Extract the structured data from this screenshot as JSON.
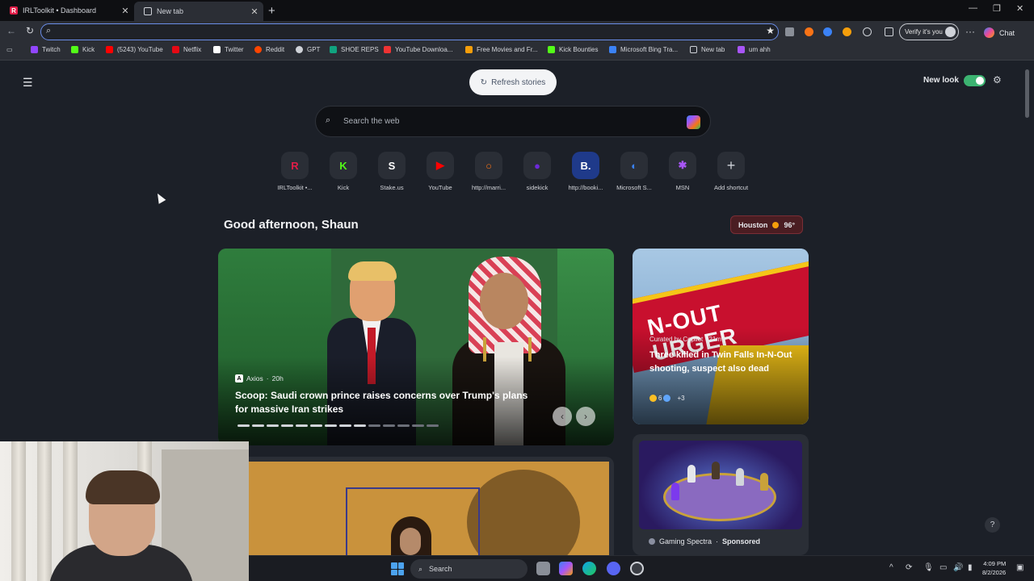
{
  "browser": {
    "tabs": [
      {
        "title": "IRLToolkit • Dashboard"
      },
      {
        "title": "New tab"
      }
    ],
    "new_tab_symbol": "+",
    "address": {
      "value": "",
      "placeholder": ""
    },
    "verify_label": "Verify it's you",
    "chat_label": "Chat",
    "more_symbol": "···"
  },
  "bookmarks": [
    {
      "label": "Twitch",
      "color": "#9146ff"
    },
    {
      "label": "Kick",
      "color": "#53fc18"
    },
    {
      "label": "(5243) YouTube",
      "color": "#ff0000"
    },
    {
      "label": "Netflix",
      "color": "#e50914"
    },
    {
      "label": "Twitter",
      "color": "#ffffff"
    },
    {
      "label": "Reddit",
      "color": "#ff4500"
    },
    {
      "label": "GPT",
      "color": "#cfd2d8"
    },
    {
      "label": "SHOE REPS",
      "color": "#10a37f"
    },
    {
      "label": "YouTube Downloa...",
      "color": "#e33"
    },
    {
      "label": "Free Movies and Fr...",
      "color": "#f59e0b"
    },
    {
      "label": "Kick Bounties",
      "color": "#53fc18"
    },
    {
      "label": "Microsoft Bing Tra...",
      "color": "#3b82f6"
    },
    {
      "label": "New tab",
      "color": "#cfd2d8"
    },
    {
      "label": "um ahh",
      "color": "#a855f7"
    }
  ],
  "newtab": {
    "refresh_label": "Refresh stories",
    "new_look_label": "New look",
    "new_look_on": true,
    "search_placeholder": "Search the web",
    "greeting": "Good afternoon, Shaun",
    "weather": {
      "city": "Houston",
      "temp": "96°"
    },
    "help_symbol": "?"
  },
  "shortcuts": [
    {
      "label": "IRLToolkit •...",
      "glyph": "R",
      "color": "#e11d48"
    },
    {
      "label": "Kick",
      "glyph": "K",
      "color": "#53fc18"
    },
    {
      "label": "Stake.us",
      "glyph": "S",
      "color": "#ffffff"
    },
    {
      "label": "YouTube",
      "glyph": "▶",
      "color": "#ff0000"
    },
    {
      "label": "http://marri...",
      "glyph": "○",
      "color": "#f97316"
    },
    {
      "label": "sidekick",
      "glyph": "●",
      "color": "#6d28d9"
    },
    {
      "label": "http://booki...",
      "glyph": "B.",
      "color": "#ffffff"
    },
    {
      "label": "Microsoft S...",
      "glyph": "◐",
      "color": "#3b82f6"
    },
    {
      "label": "MSN",
      "glyph": "✱",
      "color": "#a855f7"
    },
    {
      "label": "Add shortcut",
      "glyph": "+",
      "color": "#cfd2d8"
    }
  ],
  "stories": {
    "main": {
      "source": "Axios",
      "source_badge": "A",
      "age": "20h",
      "headline": "Scoop: Saudi crown prince raises concerns over Trump's plans for massive Iran strikes",
      "dots_total": 14,
      "dots_active": 9
    },
    "side": {
      "source": "Curated by Copilot · 21m",
      "headline": "Three killed in Twin Falls In-N-Out shooting, suspect also dead",
      "sign_text": "N-OUT URGER",
      "reactions": "6",
      "reactions_more": "+3"
    },
    "game": {
      "source": "Gaming Spectra",
      "sponsored": "Sponsored"
    }
  },
  "taskbar": {
    "search_label": "Search",
    "time": "4:09 PM",
    "date": "8/2/2026"
  }
}
